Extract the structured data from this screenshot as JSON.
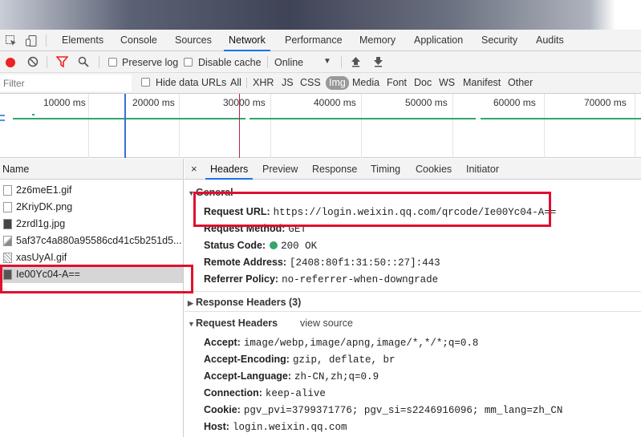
{
  "tabs": [
    "Elements",
    "Console",
    "Sources",
    "Network",
    "Performance",
    "Memory",
    "Application",
    "Security",
    "Audits"
  ],
  "active_tab": "Network",
  "toolbar": {
    "preserve_log": "Preserve log",
    "disable_cache": "Disable cache",
    "throttle": "Online"
  },
  "filter": {
    "placeholder": "Filter",
    "hide_data_urls": "Hide data URLs",
    "types": [
      "All",
      "XHR",
      "JS",
      "CSS",
      "Img",
      "Media",
      "Font",
      "Doc",
      "WS",
      "Manifest",
      "Other"
    ],
    "selected_type": "Img"
  },
  "timeline": {
    "ticks": [
      "10000 ms",
      "20000 ms",
      "30000 ms",
      "40000 ms",
      "50000 ms",
      "60000 ms",
      "70000 ms"
    ]
  },
  "requests": {
    "header": "Name",
    "items": [
      "2z6meE1.gif",
      "2KriyDK.png",
      "2zrdl1g.jpg",
      "5af37c4a880a95586cd41c5b251d5...",
      "xasUyAI.gif",
      "Ie00Yc04-A=="
    ],
    "selected": "Ie00Yc04-A=="
  },
  "detail": {
    "tabs": [
      "Headers",
      "Preview",
      "Response",
      "Timing",
      "Cookies",
      "Initiator"
    ],
    "active_tab": "Headers",
    "general_title": "General",
    "general": [
      {
        "key": "Request URL:",
        "value": "https://login.weixin.qq.com/qrcode/Ie00Yc04-A=="
      },
      {
        "key": "Request Method:",
        "value": "GET"
      },
      {
        "key": "Status Code:",
        "value": "200 OK"
      },
      {
        "key": "Remote Address:",
        "value": "[2408:80f1:31:50::27]:443"
      },
      {
        "key": "Referrer Policy:",
        "value": "no-referrer-when-downgrade"
      }
    ],
    "response_headers_title": "Response Headers (3)",
    "request_headers_title": "Request Headers",
    "view_source": "view source",
    "request_headers": [
      {
        "key": "Accept:",
        "value": "image/webp,image/apng,image/*,*/*;q=0.8"
      },
      {
        "key": "Accept-Encoding:",
        "value": "gzip, deflate, br"
      },
      {
        "key": "Accept-Language:",
        "value": "zh-CN,zh;q=0.9"
      },
      {
        "key": "Connection:",
        "value": "keep-alive"
      },
      {
        "key": "Cookie:",
        "value": "pgv_pvi=3799371776; pgv_si=s2246916096; mm_lang=zh_CN"
      },
      {
        "key": "Host:",
        "value": "login.weixin.qq.com"
      }
    ]
  },
  "colors": {
    "accent": "#1a73e8",
    "highlight": "#e0102f",
    "status_ok": "#31a76b"
  }
}
